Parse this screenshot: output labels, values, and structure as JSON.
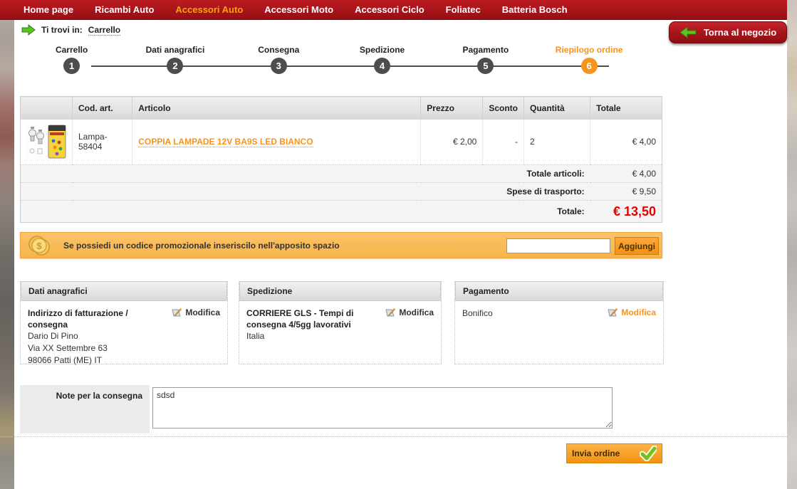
{
  "nav": {
    "items": [
      {
        "label": "Home page",
        "active": false
      },
      {
        "label": "Ricambi Auto",
        "active": false
      },
      {
        "label": "Accessori Auto",
        "active": true
      },
      {
        "label": "Accessori Moto",
        "active": false
      },
      {
        "label": "Accessori Ciclo",
        "active": false
      },
      {
        "label": "Foliatec",
        "active": false
      },
      {
        "label": "Batteria Bosch",
        "active": false
      }
    ]
  },
  "breadcrumb": {
    "prefix": "Ti trovi in:",
    "current": "Carrello"
  },
  "back_button": {
    "label": "Torna al negozio"
  },
  "steps": [
    {
      "num": "1",
      "label": "Carrello",
      "active": false
    },
    {
      "num": "2",
      "label": "Dati anagrafici",
      "active": false
    },
    {
      "num": "3",
      "label": "Consegna",
      "active": false
    },
    {
      "num": "4",
      "label": "Spedizione",
      "active": false
    },
    {
      "num": "5",
      "label": "Pagamento",
      "active": false
    },
    {
      "num": "6",
      "label": "Riepilogo ordine",
      "active": true
    }
  ],
  "order_table": {
    "headers": {
      "code": "Cod. art.",
      "article": "Articolo",
      "price": "Prezzo",
      "discount": "Sconto",
      "quantity": "Quantità",
      "total": "Totale"
    },
    "rows": [
      {
        "code": "Lampa-58404",
        "article": "COPPIA LAMPADE 12V BA9S LED BIANCO",
        "price": "€ 2,00",
        "discount": "-",
        "quantity": "2",
        "total": "€ 4,00"
      }
    ],
    "summary": [
      {
        "label": "Totale articoli:",
        "value": "€ 4,00"
      },
      {
        "label": "Spese di trasporto:",
        "value": "€ 9,50"
      }
    ],
    "grand_total": {
      "label": "Totale:",
      "value": "€ 13,50"
    }
  },
  "promo": {
    "message": "Se possiedi un codice promozionale inseriscilo nell'apposito spazio",
    "input_value": "",
    "button_label": "Aggiungi"
  },
  "boxes": [
    {
      "title": "Dati anagrafici",
      "subtitle": "Indirizzo di fatturazione / consegna",
      "lines": [
        "Dario Di Pino",
        "Via XX Settembre 63",
        "98066 Patti (ME) IT"
      ],
      "edit_label": "Modifica"
    },
    {
      "title": "Spedizione",
      "subtitle": "CORRIERE GLS - Tempi di consegna 4/5gg lavorativi",
      "lines": [
        "Italia"
      ],
      "edit_label": "Modifica"
    },
    {
      "title": "Pagamento",
      "subtitle": "Bonifico",
      "lines": [],
      "edit_label": "Modifica"
    }
  ],
  "notes": {
    "label": "Note per la consegna",
    "value": "sdsd"
  },
  "submit_button": {
    "label": "Invia ordine"
  },
  "icons": {
    "breadcrumb_arrow": "green-right-arrow",
    "back_arrow": "green-left-arrow",
    "promo_coins": "gold-coins-dollar",
    "edit": "pencil-on-page",
    "submit_check": "green-checkmark"
  },
  "colors": {
    "nav_red": "#a8141a",
    "accent_orange": "#f7941d",
    "total_red": "#e50000",
    "promo_bg": "#f8b44c",
    "step_gray": "#4d4d4d",
    "arrow_green": "#5bc421"
  }
}
